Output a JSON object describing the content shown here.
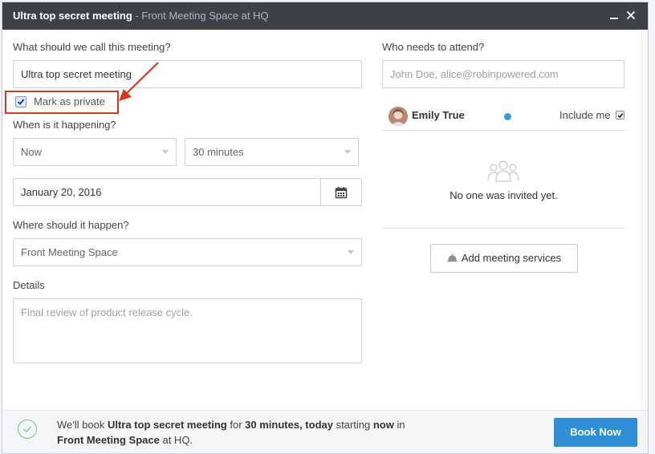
{
  "header": {
    "meeting_title": "Ultra top secret meeting",
    "location_sub": " - Front Meeting Space at HQ",
    "minimize_label": "—",
    "close_label": "✕"
  },
  "form": {
    "name_label": "What should we call this meeting?",
    "name_value": "Ultra top secret meeting",
    "private_label": "Mark as private",
    "private_checked": true,
    "when_label": "When is it happening?",
    "start_value": "Now",
    "duration_value": "30 minutes",
    "date_value": "January 20, 2016",
    "where_label": "Where should it happen?",
    "space_value": "Front Meeting Space",
    "details_label": "Details",
    "details_placeholder": "Final review of product release cycle."
  },
  "attendees": {
    "label": "Who needs to attend?",
    "placeholder": "John Doe, alice@robinpowered.com",
    "organizer_name": "Emily True",
    "include_me_label": "Include me",
    "include_me_checked": true,
    "empty_text": "No one was invited yet.",
    "services_button": "Add meeting services"
  },
  "footer": {
    "msg_1": "We'll book ",
    "msg_title": "Ultra top secret meeting",
    "msg_2": " for ",
    "msg_duration": "30 minutes, today",
    "msg_3": " starting ",
    "msg_now": "now",
    "msg_4": " in",
    "msg_space": "Front Meeting Space",
    "msg_5": " at HQ.",
    "book_button": "Book Now"
  },
  "colors": {
    "header_bg": "#3d4247",
    "primary": "#2e8fd6",
    "highlight": "#d9371f",
    "status_dot": "#3a9ad9",
    "success": "#7bc67b"
  },
  "icons": [
    "calendar-icon",
    "bell-icon",
    "people-icon",
    "check-circle-icon",
    "chevron-down-icon",
    "close-icon",
    "minimize-icon",
    "arrow-annotation"
  ]
}
